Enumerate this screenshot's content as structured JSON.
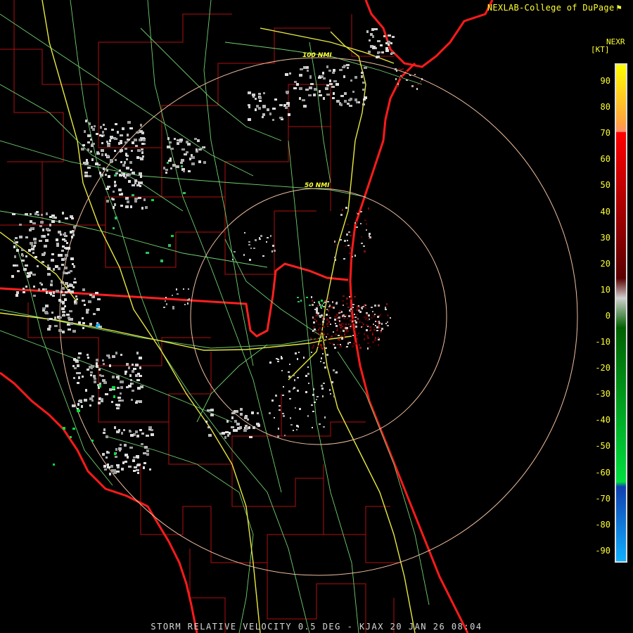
{
  "header": {
    "credit": "NEXLAB-College of DuPage",
    "credit_icon": "flag-icon"
  },
  "legend": {
    "product": "NEXR",
    "unit": "[KT]",
    "ticks": [
      "90",
      "80",
      "70",
      "60",
      "50",
      "40",
      "30",
      "20",
      "10",
      "0",
      "-10",
      "-20",
      "-30",
      "-40",
      "-50",
      "-60",
      "-70",
      "-80",
      "-90"
    ],
    "colors": {
      "high_positive": "#ffff00",
      "orange": "#ffa040",
      "salmon": "#ff9070",
      "red": "#ff0000",
      "dark_red": "#5a0000",
      "near_zero": "#d0d0d0",
      "dark_green": "#006000",
      "bright_green": "#00e040",
      "dark_blue": "#1040b0",
      "light_blue": "#10b0ff"
    }
  },
  "map": {
    "range_rings": [
      "50 NMI",
      "100 NMI"
    ],
    "radar_site": "KJAX",
    "colors": {
      "coastline": "#ff1a1a",
      "county_lines": "#b01010",
      "state_line": "#ff2020",
      "highways": "#e8e840",
      "roads": "#70d070",
      "rings": "#f0c0a0"
    }
  },
  "footer": {
    "caption": "STORM RELATIVE VELOCITY 0.5 DEG - KJAX 20 JAN 26 08:04"
  }
}
